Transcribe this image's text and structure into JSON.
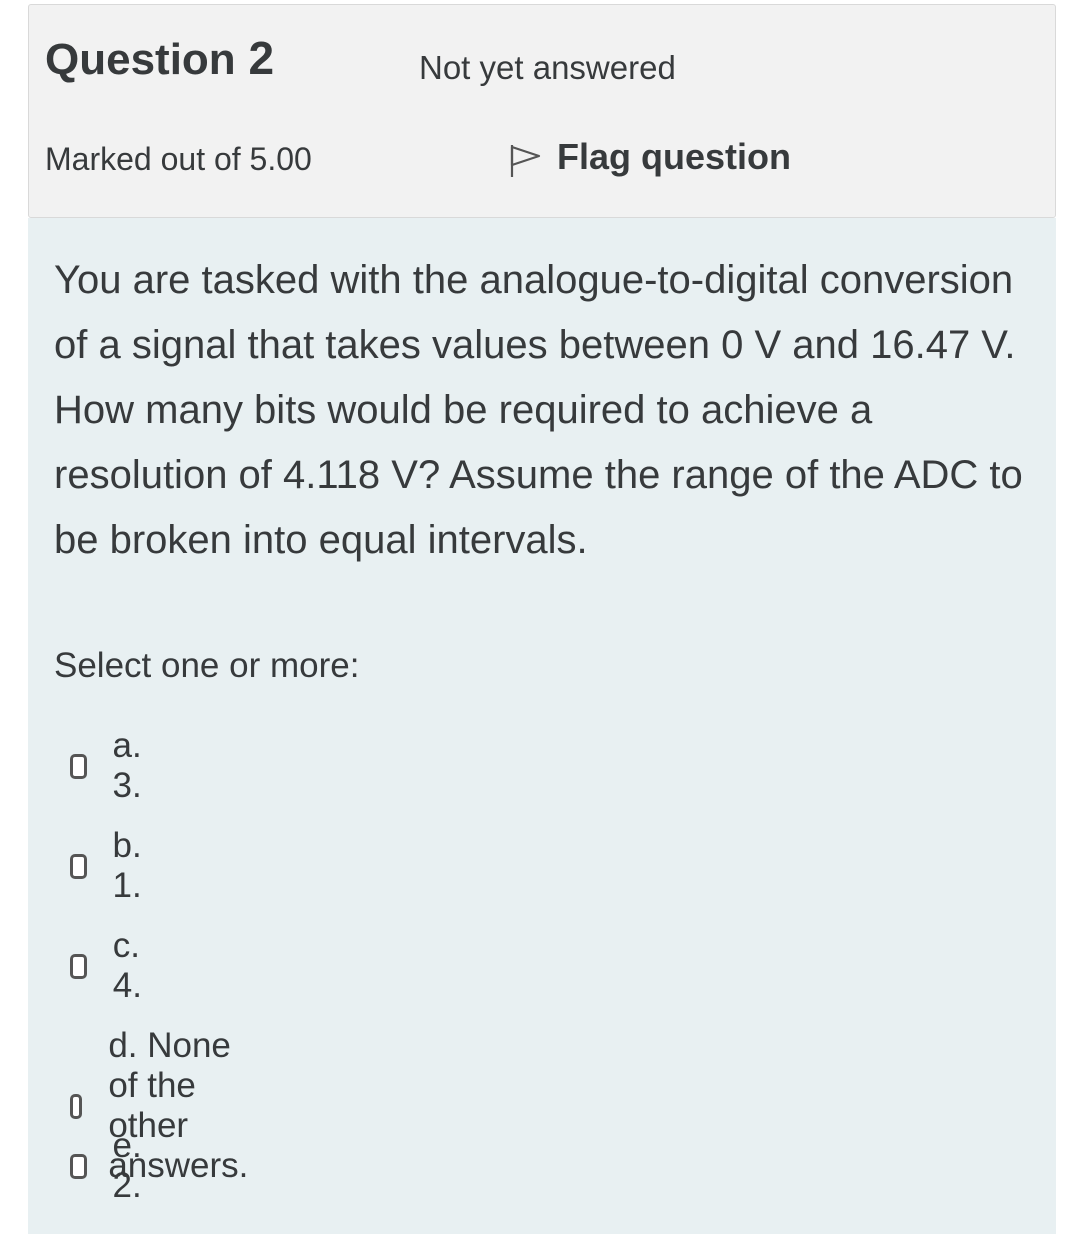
{
  "info": {
    "question_label": "Question",
    "question_number": "2",
    "state": "Not yet answered",
    "grade": "Marked out of 5.00",
    "flag_label": "Flag question"
  },
  "question": {
    "text": "You are tasked with the analogue-to-digital conversion of a signal that takes values between 0 V and 16.47 V. How many bits would be required to achieve a resolution of 4.118 V? Assume the range of the ADC to be broken into equal intervals.",
    "prompt": "Select one or more:",
    "options": [
      {
        "label": "a. 3.",
        "checked": false
      },
      {
        "label": "b. 1.",
        "checked": false
      },
      {
        "label": "c. 4.",
        "checked": false
      },
      {
        "label": "d. None of the other answers.",
        "checked": false
      },
      {
        "label": "e. 2.",
        "checked": false
      }
    ]
  },
  "colors": {
    "info_bg": "#f2f2f2",
    "content_bg": "#e8f0f2",
    "text": "#373a3c"
  }
}
